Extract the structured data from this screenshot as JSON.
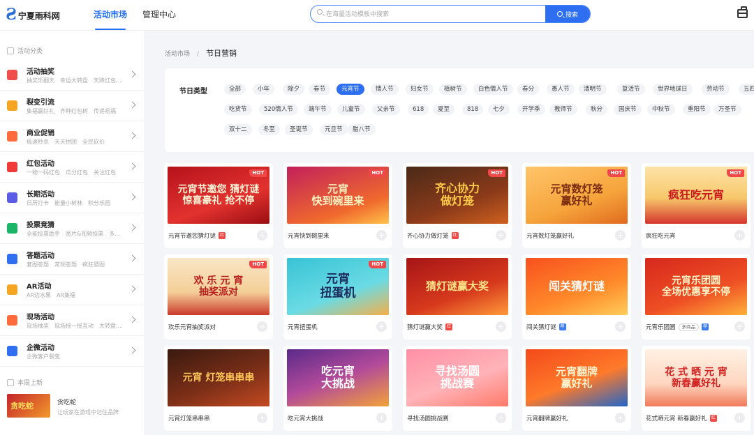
{
  "app": {
    "logo_text": "宁夏雨科网"
  },
  "nav": {
    "market": "活动市场",
    "manage": "管理中心"
  },
  "search": {
    "placeholder": "在海量活动模板中搜索",
    "button": "搜索"
  },
  "sidebar": {
    "section_title": "活动分类",
    "categories": [
      {
        "name": "活动抽奖",
        "sub": "抽奖乐翻天　幸运大转盘　天降红包...",
        "color": "#f04d4d",
        "icon": "gift-icon"
      },
      {
        "name": "裂变引流",
        "sub": "集福赢好礼　齐种红包树　传递祝福",
        "color": "#f5a623",
        "icon": "user-icon"
      },
      {
        "name": "商业促销",
        "sub": "极速秒杀　天天拼团　全民砍价",
        "color": "#ff6b3d",
        "icon": "tag-icon"
      },
      {
        "name": "红包活动",
        "sub": "一物一码红包　瓜分红包　关注红包",
        "color": "#f03a3a",
        "icon": "red-envelope-icon"
      },
      {
        "name": "长期活动",
        "sub": "日历打卡　能量小树林　积分乐园",
        "color": "#5b5ce6",
        "icon": "calendar-icon"
      },
      {
        "name": "投票竞猜",
        "sub": "全能投票助手　图片&视频投票　多...",
        "color": "#1bb567",
        "icon": "vote-icon"
      },
      {
        "name": "答题活动",
        "sub": "套图答题　常规答题　疯狂猜图",
        "color": "#2f6ff0",
        "icon": "question-icon"
      },
      {
        "name": "AR活动",
        "sub": "AR边水果　AR集福",
        "color": "#f5a623",
        "icon": "robot-icon"
      },
      {
        "name": "现场活动",
        "sub": "现场抽奖　现场摇一摇互动　大转盘...",
        "color": "#ff6b3d",
        "icon": "grid-icon"
      },
      {
        "name": "企微活动",
        "sub": "企微客户裂变",
        "color": "#2f6ff0",
        "icon": "chat-icon"
      }
    ],
    "new_title": "本周上新",
    "new_item": {
      "thumb_text": "贪吃蛇",
      "name": "贪吃蛇",
      "sub": "让玩家在游戏中记住品牌"
    }
  },
  "breadcrumb": {
    "parent": "活动市场",
    "sep": "/",
    "current": "节日营销"
  },
  "filter": {
    "label": "节日类型",
    "rows": [
      [
        "全部",
        "小年",
        "除夕",
        "春节",
        "元宵节",
        "情人节",
        "妇女节",
        "植树节",
        "白色情人节",
        "春分",
        "愚人节",
        "清明节",
        "复活节",
        "世界地球日",
        "劳动节",
        "五四"
      ],
      [
        "吃货节",
        "520情人节",
        "端午节",
        "儿童节",
        "父亲节",
        "618",
        "夏至",
        "818",
        "七夕",
        "开学季",
        "教师节",
        "秋分",
        "国庆节",
        "中秋节",
        "重阳节",
        "万圣节"
      ],
      [
        "双十二",
        "冬至",
        "圣诞节",
        "元旦节",
        "腊八节"
      ]
    ],
    "active": "元宵节"
  },
  "cards": [
    {
      "title": "元宵节邀您猜灯谜",
      "art": "元宵节邀您 猜灯谜\n惊喜豪礼 抢不停",
      "hot": "HOT",
      "badge": "红",
      "badge_color": "r",
      "bg": "linear-gradient(160deg,#b5121b,#e2322f 60%,#9a0d12)",
      "fg": "#fff6d8",
      "fs": 14
    },
    {
      "title": "元宵快到碗里来",
      "art": "元宵\n快到碗里来",
      "hot": "HOT",
      "bg": "linear-gradient(160deg,#c2205a,#f06a2d 70%,#ffc24a)",
      "fg": "#fff3c2",
      "fs": 15
    },
    {
      "title": "齐心协力做灯笼",
      "art": "齐心协力\n做灯笼",
      "hot": "HOT",
      "badge": "红",
      "badge_color": "r",
      "bg": "linear-gradient(160deg,#4a2a18,#8a3a1a 60%,#d0611e)",
      "fg": "#ffcc4a",
      "fs": 16
    },
    {
      "title": "元宵数灯笼赢好礼",
      "art": "元宵数灯笼\n赢好礼",
      "hot": "HOT",
      "bg": "linear-gradient(160deg,#ffc56a,#f6a43c 60%,#e06b1e)",
      "fg": "#7a2a0e",
      "fs": 15
    },
    {
      "title": "疯狂吃元宵",
      "art": "疯狂吃元宵",
      "hot": "HOT",
      "bg": "linear-gradient(180deg,#fde3a8,#f7c86a 55%,#d4352d)",
      "fg": "#c9171c",
      "fs": 16
    },
    {
      "title": "欢乐元宵抽奖派对",
      "art": "欢 乐 元 宵\n抽奖派对",
      "hot": "HOT",
      "bg": "linear-gradient(180deg,#f9e6c6,#f4cf98 60%,#c93a2a)",
      "fg": "#b71c1c",
      "fs": 14
    },
    {
      "title": "元宵扭蛋机",
      "art": "元宵\n扭蛋机",
      "hot": "HOT",
      "bg": "linear-gradient(160deg,#38c3d6,#6adbe4 60%,#f5b04a)",
      "fg": "#1b2a5a",
      "fs": 17
    },
    {
      "title": "猜灯谜赢大奖",
      "art": "猜灯谜赢大奖",
      "badge": "红",
      "badge_color": "r",
      "bg": "linear-gradient(160deg,#a61417,#d6391c 60%,#ff9a3a)",
      "fg": "#ffe58a",
      "fs": 15
    },
    {
      "title": "闯关猜灯谜",
      "art": "闯关猜灯谜",
      "badge": "荐",
      "badge_color": "b",
      "bg": "linear-gradient(160deg,#f7511e,#ff8a2a 60%,#ffcd5a)",
      "fg": "#fff",
      "fs": 16
    },
    {
      "title": "元宵乐团圆",
      "art": "元宵乐团圆\n全场优惠享不停",
      "chip": "多商品",
      "badge": "荐",
      "badge_color": "b",
      "bg": "linear-gradient(160deg,#d6281d,#ee4f24 60%,#ffb23a)",
      "fg": "#fff6c8",
      "fs": 14
    },
    {
      "title": "元宵灯笼串串串",
      "art": "元宵 灯笼串串串",
      "bg": "linear-gradient(160deg,#3a1a10,#7a2e17 55%,#c44a22)",
      "fg": "#ffc85a",
      "fs": 14
    },
    {
      "title": "吃元宵大挑战",
      "art": "吃元宵\n大挑战",
      "bg": "linear-gradient(160deg,#5a2a8a,#b24a9a 50%,#f2a23a)",
      "fg": "#fff",
      "fs": 16
    },
    {
      "title": "寻找汤圆挑战赛",
      "art": "寻找汤圆\n挑战赛",
      "bg": "linear-gradient(160deg,#ff8fa6,#ffb3b8 55%,#ff7a6a)",
      "fg": "#fff",
      "fs": 16
    },
    {
      "title": "元宵翻牌赢好礼",
      "art": "元宵翻牌\n赢好礼",
      "bg": "linear-gradient(160deg,#f34a1a,#ff7a2a 55%,#2266c8)",
      "fg": "#fff5d0",
      "fs": 15
    },
    {
      "title": "花式晒元宵 新春赢好礼",
      "art": "花 式 晒 元 宵\n新春赢好礼",
      "badge": "红",
      "badge_color": "r",
      "bg": "linear-gradient(180deg,#fff1e4,#ffd6c0 60%,#f07a5a)",
      "fg": "#d02020",
      "fs": 14
    }
  ]
}
